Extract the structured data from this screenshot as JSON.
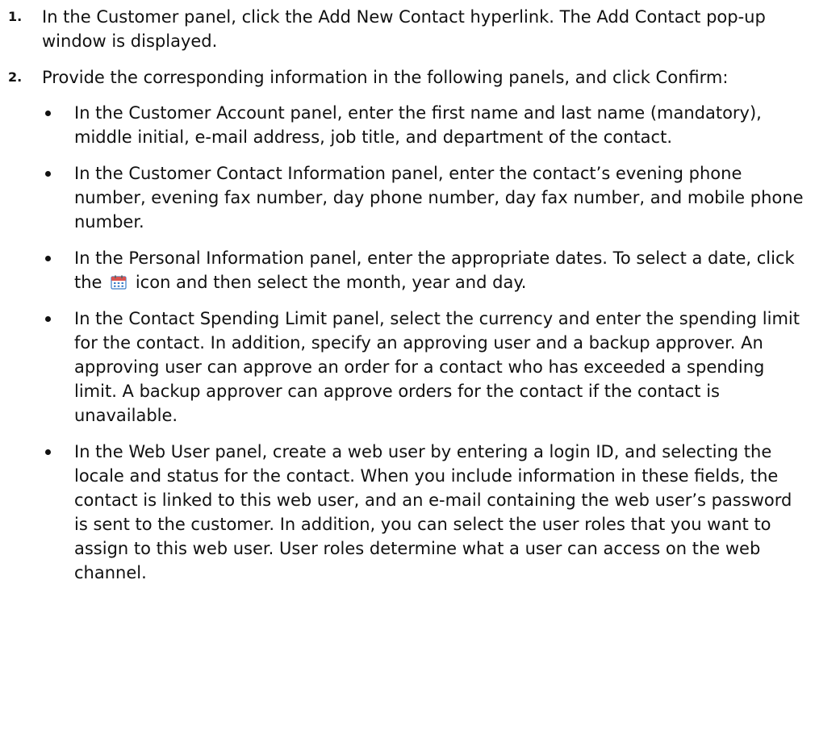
{
  "steps": [
    {
      "number": "1.",
      "text": "In the Customer panel, click the Add New Contact hyperlink. The Add Contact pop-up window is displayed."
    },
    {
      "number": "2.",
      "text": "Provide the corresponding information in the following panels, and click Confirm:",
      "bullets": [
        "In the Customer Account panel, enter the first name and last name (mandatory), middle initial, e-mail address, job title, and department of the contact.",
        "In the Customer Contact Information panel, enter the contact’s evening phone number, evening fax number, day phone number, day fax number, and mobile phone number.",
        {
          "before_icon": "In the Personal Information panel, enter the appropriate dates. To select a date, click the",
          "icon": "calendar-icon",
          "after_icon": "icon and then select the month, year and day."
        },
        "In the Contact Spending Limit panel, select the currency and enter the spending limit for the contact. In addition, specify an approving user and a backup approver. An approving user can approve an order for a contact who has exceeded a spending limit. A backup approver can approve orders for the contact if the contact is unavailable.",
        "In the Web User panel, create a web user by entering a login ID, and selecting the locale and status for the contact. When you include information in these fields, the contact is linked to this web user, and an e-mail containing the web user’s password is sent to the customer. In addition, you can select the user roles that you want to assign to this web user. User roles determine what a user can access on the web channel."
      ]
    }
  ],
  "colors": {
    "text": "#111111",
    "calendar_header": "#d9534f",
    "calendar_grid": "#3a7bc8"
  }
}
